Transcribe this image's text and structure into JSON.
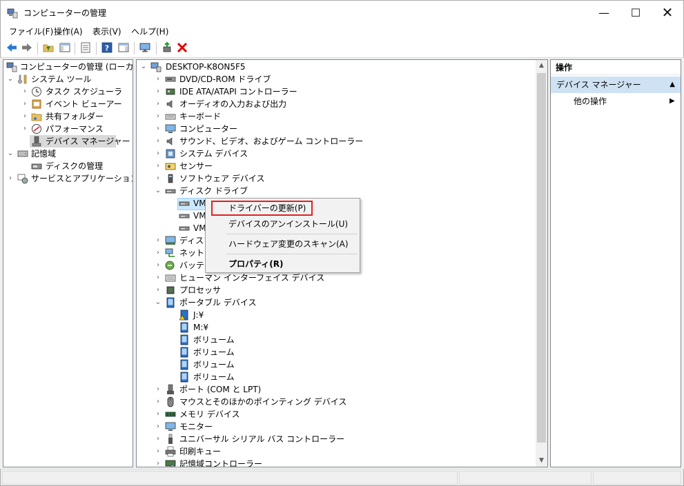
{
  "window": {
    "title": "コンピューターの管理",
    "minimize_label": "—",
    "maximize_label": "☐",
    "close_label": "✕"
  },
  "menu": {
    "file": "ファイル(F)",
    "action": "操作(A)",
    "view": "表示(V)",
    "help": "ヘルプ(H)"
  },
  "left_tree": {
    "root": "コンピューターの管理 (ローカル)",
    "system_tools": "システム ツール",
    "task_scheduler": "タスク スケジューラ",
    "event_viewer": "イベント ビューアー",
    "shared_folders": "共有フォルダー",
    "performance": "パフォーマンス",
    "device_manager": "デバイス マネージャー",
    "storage": "記憶域",
    "disk_management": "ディスクの管理",
    "services_apps": "サービスとアプリケーション"
  },
  "device_tree": {
    "root": "DESKTOP-K8ON5F5",
    "dvd": "DVD/CD-ROM ドライブ",
    "ide": "IDE ATA/ATAPI コントローラー",
    "audio_io": "オーディオの入力および出力",
    "keyboard": "キーボード",
    "computer": "コンピューター",
    "sound": "サウンド、ビデオ、およびゲーム コントローラー",
    "system_devices": "システム デバイス",
    "sensors": "センサー",
    "software_devices": "ソフトウェア デバイス",
    "disk_drives": "ディスク ドライブ",
    "vm1": "VM",
    "vm2": "VM",
    "vm3": "VM",
    "display": "ディスプ",
    "network": "ネットワ",
    "battery": "バッテリ",
    "hid": "ヒューマン インターフェイス デバイス",
    "processor": "プロセッサ",
    "portable": "ポータブル デバイス",
    "j_drive": "J:¥",
    "m_drive": "M:¥",
    "volume1": "ボリューム",
    "volume2": "ボリューム",
    "volume3": "ボリューム",
    "volume4": "ボリューム",
    "ports": "ポート (COM と LPT)",
    "mouse": "マウスとそのほかのポインティング デバイス",
    "memory": "メモリ デバイス",
    "monitor": "モニター",
    "usb": "ユニバーサル シリアル バス コントローラー",
    "print_queue": "印刷キュー",
    "storage_ctrl": "記憶域コントローラー"
  },
  "context_menu": {
    "update_driver": "ドライバーの更新(P)",
    "uninstall": "デバイスのアンインストール(U)",
    "scan": "ハードウェア変更のスキャン(A)",
    "properties": "プロパティ(R)"
  },
  "actions_pane": {
    "header": "操作",
    "section": "デバイス マネージャー",
    "other_actions": "他の操作"
  },
  "colors": {
    "selection": "#cce8ff",
    "section_bg": "#cfe2f3",
    "highlight_border": "#e0201e",
    "delete_red": "#e00000"
  }
}
